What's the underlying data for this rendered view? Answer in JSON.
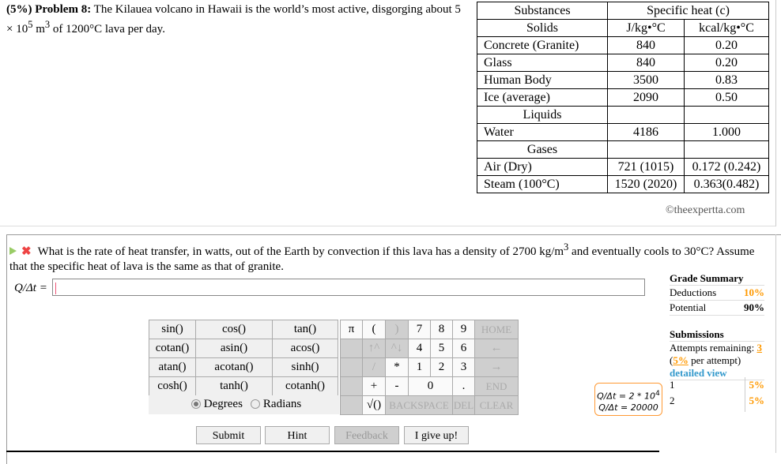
{
  "problem": {
    "prefix": "(5%) Problem 8:",
    "text": " The Kilauea volcano in Hawaii is the world’s most active, disgorging about 5 × 10",
    "exp1": "5",
    "mid": " m",
    "exp2": "3",
    "tail": " of 1200°C lava per day."
  },
  "table": {
    "header": [
      "Substances",
      "Specific heat (c)"
    ],
    "rows": [
      [
        "Solids",
        "J/kg•°C",
        "kcal/kg•°C"
      ],
      [
        "Concrete (Granite)",
        "840",
        "0.20"
      ],
      [
        "Glass",
        "840",
        "0.20"
      ],
      [
        "Human Body",
        "3500",
        "0.83"
      ],
      [
        "Ice (average)",
        "2090",
        "0.50"
      ],
      [
        "Liquids",
        "",
        ""
      ],
      [
        "Water",
        "4186",
        "1.000"
      ],
      [
        "Gases",
        "",
        ""
      ],
      [
        "Air (Dry)",
        "721 (1015)",
        "0.172 (0.242)"
      ],
      [
        "Steam (100°C)",
        "1520 (2020)",
        "0.363(0.482)"
      ]
    ]
  },
  "copyright": "©theexpertta.com",
  "question": {
    "text1": "What is the rate of heat transfer, in watts, out of the Earth by convection if this lava has a density of 2700 kg/m",
    "exp": "3",
    "text2": " and eventually cools to 30°C? Assume that the specific heat of lava is the same as that of granite.",
    "label": "Q/Δt =",
    "value": ""
  },
  "functions": [
    [
      "sin()",
      "cos()",
      "tan()"
    ],
    [
      "cotan()",
      "asin()",
      "acos()"
    ],
    [
      "atan()",
      "acotan()",
      "sinh()"
    ],
    [
      "cosh()",
      "tanh()",
      "cotanh()"
    ]
  ],
  "angle": {
    "degrees": "Degrees",
    "radians": "Radians",
    "selected": "Degrees"
  },
  "keypad": {
    "pi": "π",
    "lp": "(",
    "rp": ")",
    "k7": "7",
    "k8": "8",
    "k9": "9",
    "home": "HOME",
    "up": "↑^",
    "down": "^↓",
    "k4": "4",
    "k5": "5",
    "k6": "6",
    "left": "←",
    "div": "/",
    "mul": "*",
    "k1": "1",
    "k2": "2",
    "k3": "3",
    "right": "→",
    "plus": "+",
    "minus": "-",
    "k0": "0",
    "dot": ".",
    "end": "END",
    "sqrt": "√()",
    "backspace": "BACKSPACE",
    "del": "DEL",
    "clear": "CLEAR"
  },
  "buttons": {
    "submit": "Submit",
    "hint": "Hint",
    "feedback": "Feedback",
    "giveup": "I give up!"
  },
  "grade": {
    "title": "Grade Summary",
    "deductions_label": "Deductions",
    "deductions": "10%",
    "potential_label": "Potential",
    "potential": "90%",
    "submissions_title": "Submissions",
    "attempts_label": "Attempts remaining: ",
    "attempts": "3",
    "per_open": "(",
    "per": "5%",
    "per_close": " per attempt)",
    "detailed": "detailed view"
  },
  "submissions": [
    {
      "n": "1",
      "pct": "5%"
    },
    {
      "n": "2",
      "pct": "5%"
    }
  ],
  "tooltip": {
    "line1": "Q/Δt = 2 * 10",
    "exp": "4",
    "line2": "Q/Δt = 20000"
  },
  "colors": {
    "accent": "#ff9900",
    "link": "#3399cc"
  }
}
